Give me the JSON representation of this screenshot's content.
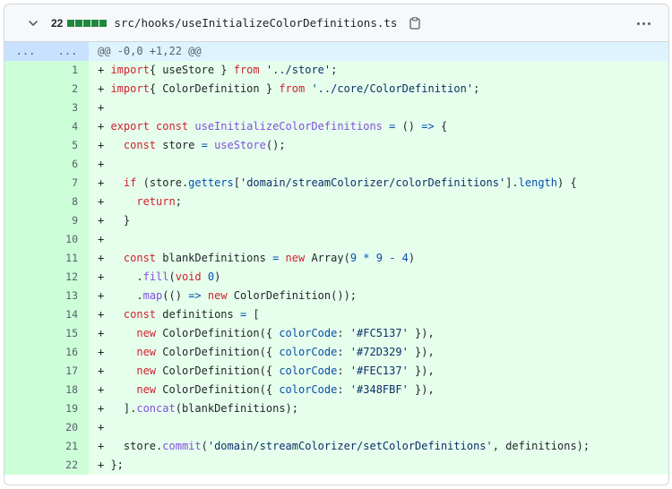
{
  "file": {
    "change_count": "22",
    "path": "src/hooks/useInitializeColorDefinitions.ts",
    "diffstat_colors": [
      "#1f883d",
      "#1f883d",
      "#1f883d",
      "#1f883d",
      "#1f883d"
    ]
  },
  "hunk": {
    "expand_left": "...",
    "expand_right": "...",
    "header": "@@ -0,0 +1,22 @@"
  },
  "lines": [
    {
      "n": "1",
      "tokens": [
        [
          "sign",
          "+ "
        ],
        [
          "kw",
          "import"
        ],
        [
          "",
          "{ useStore } "
        ],
        [
          "kw",
          "from"
        ],
        [
          "str",
          " '../store'"
        ],
        [
          "",
          ";"
        ]
      ]
    },
    {
      "n": "2",
      "tokens": [
        [
          "sign",
          "+ "
        ],
        [
          "kw",
          "import"
        ],
        [
          "",
          "{ ColorDefinition } "
        ],
        [
          "kw",
          "from"
        ],
        [
          "str",
          " '../core/ColorDefinition'"
        ],
        [
          "",
          ";"
        ]
      ]
    },
    {
      "n": "3",
      "tokens": [
        [
          "sign",
          "+"
        ]
      ]
    },
    {
      "n": "4",
      "tokens": [
        [
          "sign",
          "+ "
        ],
        [
          "kw",
          "export const "
        ],
        [
          "fn",
          "useInitializeColorDefinitions"
        ],
        [
          "op",
          " = "
        ],
        [
          "",
          "() "
        ],
        [
          "op",
          "=>"
        ],
        [
          "",
          " {"
        ]
      ]
    },
    {
      "n": "5",
      "tokens": [
        [
          "sign",
          "+   "
        ],
        [
          "kw",
          "const "
        ],
        [
          "",
          "store "
        ],
        [
          "op",
          "="
        ],
        [
          "fn",
          " useStore"
        ],
        [
          "",
          "();"
        ]
      ]
    },
    {
      "n": "6",
      "tokens": [
        [
          "sign",
          "+"
        ]
      ]
    },
    {
      "n": "7",
      "tokens": [
        [
          "sign",
          "+   "
        ],
        [
          "kw",
          "if "
        ],
        [
          "",
          "(store."
        ],
        [
          "prop",
          "getters"
        ],
        [
          "",
          "["
        ],
        [
          "str",
          "'domain/streamColorizer/colorDefinitions'"
        ],
        [
          "",
          "]."
        ],
        [
          "prop",
          "length"
        ],
        [
          "",
          ") {"
        ]
      ]
    },
    {
      "n": "8",
      "tokens": [
        [
          "sign",
          "+     "
        ],
        [
          "kw",
          "return"
        ],
        [
          "",
          ";"
        ]
      ]
    },
    {
      "n": "9",
      "tokens": [
        [
          "sign",
          "+   "
        ],
        [
          "",
          "}"
        ]
      ]
    },
    {
      "n": "10",
      "tokens": [
        [
          "sign",
          "+"
        ]
      ]
    },
    {
      "n": "11",
      "tokens": [
        [
          "sign",
          "+   "
        ],
        [
          "kw",
          "const "
        ],
        [
          "",
          "blankDefinitions "
        ],
        [
          "op",
          "="
        ],
        [
          "kw",
          " new "
        ],
        [
          "",
          "Array("
        ],
        [
          "num",
          "9"
        ],
        [
          "op",
          " * "
        ],
        [
          "num",
          "9"
        ],
        [
          "op",
          " - "
        ],
        [
          "num",
          "4"
        ],
        [
          "",
          ")"
        ]
      ]
    },
    {
      "n": "12",
      "tokens": [
        [
          "sign",
          "+     "
        ],
        [
          "",
          "."
        ],
        [
          "fn",
          "fill"
        ],
        [
          "",
          "("
        ],
        [
          "kw",
          "void "
        ],
        [
          "num",
          "0"
        ],
        [
          "",
          ")"
        ]
      ]
    },
    {
      "n": "13",
      "tokens": [
        [
          "sign",
          "+     "
        ],
        [
          "",
          "."
        ],
        [
          "fn",
          "map"
        ],
        [
          "",
          "(() "
        ],
        [
          "op",
          "=>"
        ],
        [
          "kw",
          " new "
        ],
        [
          "",
          "ColorDefinition());"
        ]
      ]
    },
    {
      "n": "14",
      "tokens": [
        [
          "sign",
          "+   "
        ],
        [
          "kw",
          "const "
        ],
        [
          "",
          "definitions "
        ],
        [
          "op",
          "="
        ],
        [
          "",
          " ["
        ]
      ]
    },
    {
      "n": "15",
      "tokens": [
        [
          "sign",
          "+     "
        ],
        [
          "kw",
          "new "
        ],
        [
          "",
          "ColorDefinition({ "
        ],
        [
          "prop",
          "colorCode"
        ],
        [
          "",
          ": "
        ],
        [
          "str",
          "'#FC5137'"
        ],
        [
          "",
          " }),"
        ]
      ]
    },
    {
      "n": "16",
      "tokens": [
        [
          "sign",
          "+     "
        ],
        [
          "kw",
          "new "
        ],
        [
          "",
          "ColorDefinition({ "
        ],
        [
          "prop",
          "colorCode"
        ],
        [
          "",
          ": "
        ],
        [
          "str",
          "'#72D329'"
        ],
        [
          "",
          " }),"
        ]
      ]
    },
    {
      "n": "17",
      "tokens": [
        [
          "sign",
          "+     "
        ],
        [
          "kw",
          "new "
        ],
        [
          "",
          "ColorDefinition({ "
        ],
        [
          "prop",
          "colorCode"
        ],
        [
          "",
          ": "
        ],
        [
          "str",
          "'#FEC137'"
        ],
        [
          "",
          " }),"
        ]
      ]
    },
    {
      "n": "18",
      "tokens": [
        [
          "sign",
          "+     "
        ],
        [
          "kw",
          "new "
        ],
        [
          "",
          "ColorDefinition({ "
        ],
        [
          "prop",
          "colorCode"
        ],
        [
          "",
          ": "
        ],
        [
          "str",
          "'#348FBF'"
        ],
        [
          "",
          " }),"
        ]
      ]
    },
    {
      "n": "19",
      "tokens": [
        [
          "sign",
          "+   "
        ],
        [
          "",
          "]."
        ],
        [
          "fn",
          "concat"
        ],
        [
          "",
          "(blankDefinitions);"
        ]
      ]
    },
    {
      "n": "20",
      "tokens": [
        [
          "sign",
          "+"
        ]
      ]
    },
    {
      "n": "21",
      "tokens": [
        [
          "sign",
          "+   "
        ],
        [
          "",
          "store."
        ],
        [
          "fn",
          "commit"
        ],
        [
          "",
          "("
        ],
        [
          "str",
          "'domain/streamColorizer/setColorDefinitions'"
        ],
        [
          "",
          ", definitions);"
        ]
      ]
    },
    {
      "n": "22",
      "tokens": [
        [
          "sign",
          "+ "
        ],
        [
          "",
          "};"
        ]
      ]
    }
  ]
}
